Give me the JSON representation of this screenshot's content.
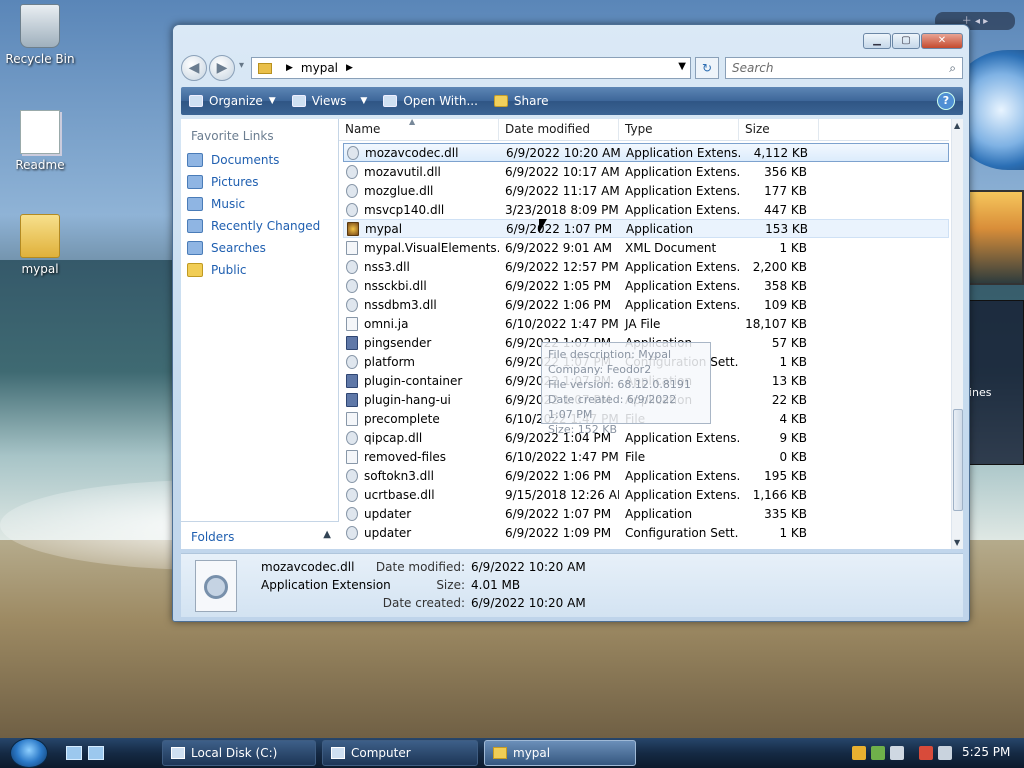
{
  "desktop": {
    "icons": [
      {
        "label": "Recycle Bin"
      },
      {
        "label": "Readme"
      },
      {
        "label": "mypal"
      }
    ],
    "gadget_news_text": "ines"
  },
  "window": {
    "caption_buttons": {
      "minimize": "",
      "maximize": "",
      "close": ""
    },
    "address": {
      "crumbs": [
        "mypal"
      ]
    },
    "search": {
      "placeholder": "Search"
    },
    "toolbar": {
      "organize": "Organize",
      "views": "Views",
      "open_with": "Open With...",
      "share": "Share",
      "help": "?"
    },
    "nav": {
      "header": "Favorite Links",
      "links": [
        "Documents",
        "Pictures",
        "Music",
        "Recently Changed",
        "Searches",
        "Public"
      ],
      "folders_label": "Folders"
    },
    "columns": {
      "name": "Name",
      "date": "Date modified",
      "type": "Type",
      "size": "Size"
    },
    "files": [
      {
        "name": "mozavcodec.dll",
        "date": "6/9/2022 10:20 AM",
        "type": "Application Extens...",
        "size": "4,112 KB",
        "icon": "dll-icon",
        "state": "selected"
      },
      {
        "name": "mozavutil.dll",
        "date": "6/9/2022 10:17 AM",
        "type": "Application Extens...",
        "size": "356 KB",
        "icon": "dll-icon"
      },
      {
        "name": "mozglue.dll",
        "date": "6/9/2022 11:17 AM",
        "type": "Application Extens...",
        "size": "177 KB",
        "icon": "dll-icon"
      },
      {
        "name": "msvcp140.dll",
        "date": "3/23/2018 8:09 PM",
        "type": "Application Extens...",
        "size": "447 KB",
        "icon": "dll-icon"
      },
      {
        "name": "mypal",
        "date": "6/9/2022 1:07 PM",
        "type": "Application",
        "size": "153 KB",
        "icon": "mypal-app-icon",
        "state": "hover"
      },
      {
        "name": "mypal.VisualElements...",
        "date": "6/9/2022 9:01 AM",
        "type": "XML Document",
        "size": "1 KB",
        "icon": "xml-icon"
      },
      {
        "name": "nss3.dll",
        "date": "6/9/2022 12:57 PM",
        "type": "Application Extens...",
        "size": "2,200 KB",
        "icon": "dll-icon"
      },
      {
        "name": "nssckbi.dll",
        "date": "6/9/2022 1:05 PM",
        "type": "Application Extens...",
        "size": "358 KB",
        "icon": "dll-icon"
      },
      {
        "name": "nssdbm3.dll",
        "date": "6/9/2022 1:06 PM",
        "type": "Application Extens...",
        "size": "109 KB",
        "icon": "dll-icon"
      },
      {
        "name": "omni.ja",
        "date": "6/10/2022 1:47 PM",
        "type": "JA File",
        "size": "18,107 KB",
        "icon": "file-icon"
      },
      {
        "name": "pingsender",
        "date": "6/9/2022 1:07 PM",
        "type": "Application",
        "size": "57 KB",
        "icon": "app-icon"
      },
      {
        "name": "platform",
        "date": "6/9/2022 1:07 PM",
        "type": "Configuration Sett...",
        "size": "1 KB",
        "icon": "config-icon"
      },
      {
        "name": "plugin-container",
        "date": "6/9/2022 1:07 PM",
        "type": "Application",
        "size": "13 KB",
        "icon": "app-icon"
      },
      {
        "name": "plugin-hang-ui",
        "date": "6/9/2022 1:07 PM",
        "type": "Application",
        "size": "22 KB",
        "icon": "app-icon"
      },
      {
        "name": "precomplete",
        "date": "6/10/2022 1:47 PM",
        "type": "File",
        "size": "4 KB",
        "icon": "file-icon"
      },
      {
        "name": "qipcap.dll",
        "date": "6/9/2022 1:04 PM",
        "type": "Application Extens...",
        "size": "9 KB",
        "icon": "dll-icon"
      },
      {
        "name": "removed-files",
        "date": "6/10/2022 1:47 PM",
        "type": "File",
        "size": "0 KB",
        "icon": "file-icon"
      },
      {
        "name": "softokn3.dll",
        "date": "6/9/2022 1:06 PM",
        "type": "Application Extens...",
        "size": "195 KB",
        "icon": "dll-icon"
      },
      {
        "name": "ucrtbase.dll",
        "date": "9/15/2018 12:26 AM",
        "type": "Application Extens...",
        "size": "1,166 KB",
        "icon": "dll-icon"
      },
      {
        "name": "updater",
        "date": "6/9/2022 1:07 PM",
        "type": "Application",
        "size": "335 KB",
        "icon": "updater-icon"
      },
      {
        "name": "updater",
        "date": "6/9/2022 1:09 PM",
        "type": "Configuration Sett...",
        "size": "1 KB",
        "icon": "config-icon"
      }
    ],
    "tooltip": {
      "lines": [
        "File description: Mypal",
        "Company: Feodor2",
        "File version: 68.12.0.8191",
        "Date created: 6/9/2022 1:07 PM",
        "Size: 152 KB"
      ]
    },
    "details": {
      "name": "mozavcodec.dll",
      "type": "Application Extension",
      "date_modified_label": "Date modified:",
      "date_modified": "6/9/2022 10:20 AM",
      "size_label": "Size:",
      "size": "4.01 MB",
      "date_created_label": "Date created:",
      "date_created": "6/9/2022 10:20 AM"
    }
  },
  "taskbar": {
    "buttons": [
      "Local Disk (C:)",
      "Computer",
      "mypal"
    ],
    "active": "mypal",
    "clock": "5:25 PM"
  }
}
